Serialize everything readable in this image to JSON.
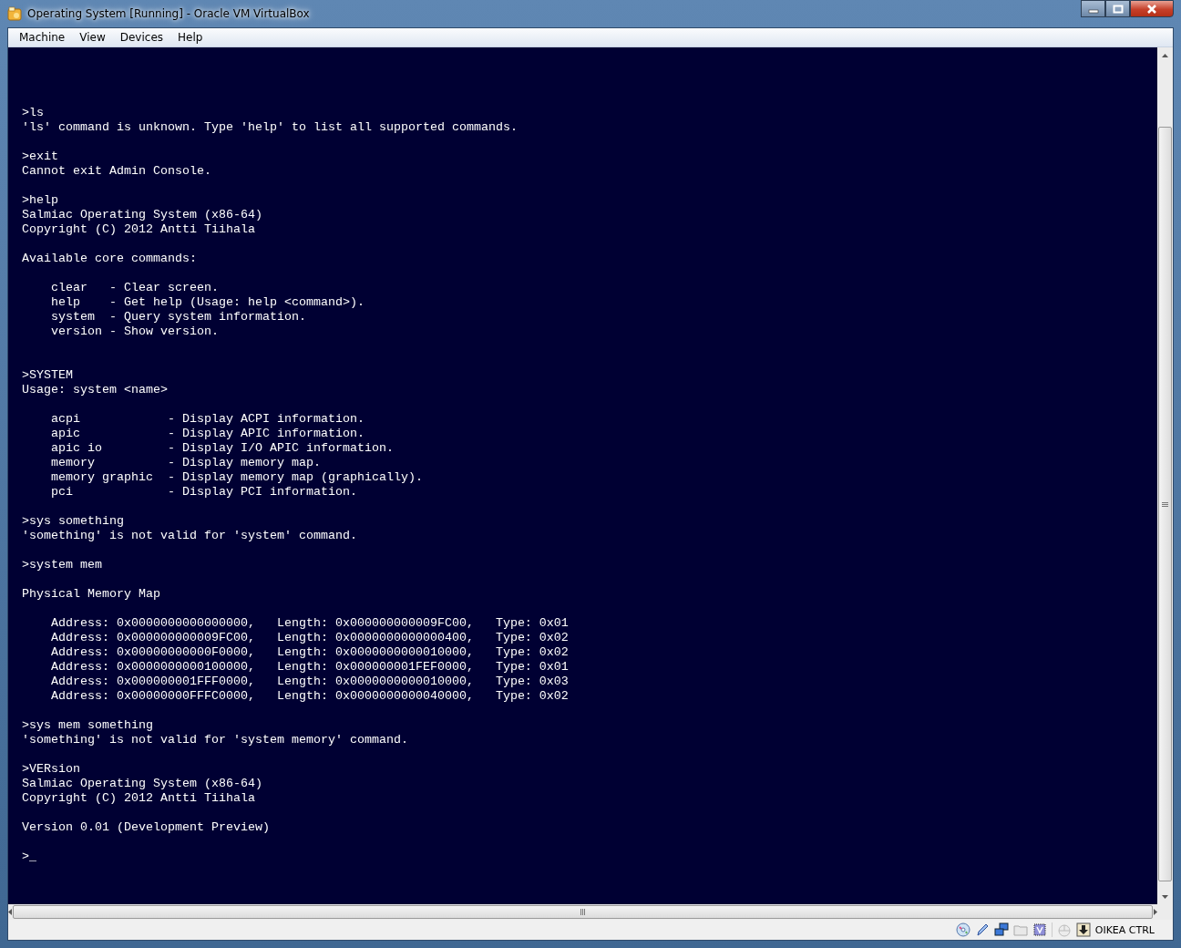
{
  "window": {
    "title": "Operating System [Running] - Oracle VM VirtualBox"
  },
  "menu": [
    "Machine",
    "View",
    "Devices",
    "Help"
  ],
  "console": {
    "lines": [
      {
        "kind": "blank"
      },
      {
        "kind": "blank"
      },
      {
        "kind": "blank"
      },
      {
        "kind": "blank"
      },
      {
        "kind": "text",
        "text": ">ls"
      },
      {
        "kind": "text",
        "text": "'ls' command is unknown. Type 'help' to list all supported commands."
      },
      {
        "kind": "blank"
      },
      {
        "kind": "text",
        "text": ">exit"
      },
      {
        "kind": "text",
        "text": "Cannot exit Admin Console."
      },
      {
        "kind": "blank"
      },
      {
        "kind": "text",
        "text": ">help"
      },
      {
        "kind": "text",
        "text": "Salmiac Operating System (x86-64)"
      },
      {
        "kind": "text",
        "text": "Copyright (C) 2012 Antti Tiihala"
      },
      {
        "kind": "blank"
      },
      {
        "kind": "text",
        "text": "Available core commands:"
      },
      {
        "kind": "blank"
      },
      {
        "kind": "text",
        "text": "    clear   - Clear screen."
      },
      {
        "kind": "text",
        "text": "    help    - Get help (Usage: help <command>)."
      },
      {
        "kind": "text",
        "text": "    system  - Query system information."
      },
      {
        "kind": "text",
        "text": "    version - Show version."
      },
      {
        "kind": "blank"
      },
      {
        "kind": "blank"
      },
      {
        "kind": "text",
        "text": ">SYSTEM"
      },
      {
        "kind": "text",
        "text": "Usage: system <name>"
      },
      {
        "kind": "blank"
      },
      {
        "kind": "text",
        "text": "    acpi            - Display ACPI information."
      },
      {
        "kind": "text",
        "text": "    apic            - Display APIC information."
      },
      {
        "kind": "text",
        "text": "    apic io         - Display I/O APIC information."
      },
      {
        "kind": "text",
        "text": "    memory          - Display memory map."
      },
      {
        "kind": "text",
        "text": "    memory graphic  - Display memory map (graphically)."
      },
      {
        "kind": "text",
        "text": "    pci             - Display PCI information."
      },
      {
        "kind": "blank"
      },
      {
        "kind": "text",
        "text": ">sys something"
      },
      {
        "kind": "text",
        "text": "'something' is not valid for 'system' command."
      },
      {
        "kind": "blank"
      },
      {
        "kind": "text",
        "text": ">system mem"
      },
      {
        "kind": "blank"
      },
      {
        "kind": "text",
        "text": "Physical Memory Map"
      },
      {
        "kind": "blank"
      },
      {
        "kind": "text",
        "text": "    Address: 0x0000000000000000,   Length: 0x000000000009FC00,   Type: 0x01"
      },
      {
        "kind": "text",
        "text": "    Address: 0x000000000009FC00,   Length: 0x0000000000000400,   Type: 0x02"
      },
      {
        "kind": "text",
        "text": "    Address: 0x00000000000F0000,   Length: 0x0000000000010000,   Type: 0x02"
      },
      {
        "kind": "text",
        "text": "    Address: 0x0000000000100000,   Length: 0x000000001FEF0000,   Type: 0x01"
      },
      {
        "kind": "text",
        "text": "    Address: 0x000000001FFF0000,   Length: 0x0000000000010000,   Type: 0x03"
      },
      {
        "kind": "text",
        "text": "    Address: 0x00000000FFFC0000,   Length: 0x0000000000040000,   Type: 0x02"
      },
      {
        "kind": "blank"
      },
      {
        "kind": "text",
        "text": ">sys mem something"
      },
      {
        "kind": "text",
        "text": "'something' is not valid for 'system memory' command."
      },
      {
        "kind": "blank"
      },
      {
        "kind": "text",
        "text": ">VERsion"
      },
      {
        "kind": "text",
        "text": "Salmiac Operating System (x86-64)"
      },
      {
        "kind": "text",
        "text": "Copyright (C) 2012 Antti Tiihala"
      },
      {
        "kind": "blank"
      },
      {
        "kind": "text",
        "text": "Version 0.01 (Development Preview)"
      },
      {
        "kind": "blank"
      },
      {
        "kind": "text",
        "text": ">_"
      }
    ]
  },
  "status_bar": {
    "host_key": "OIKEA CTRL"
  }
}
